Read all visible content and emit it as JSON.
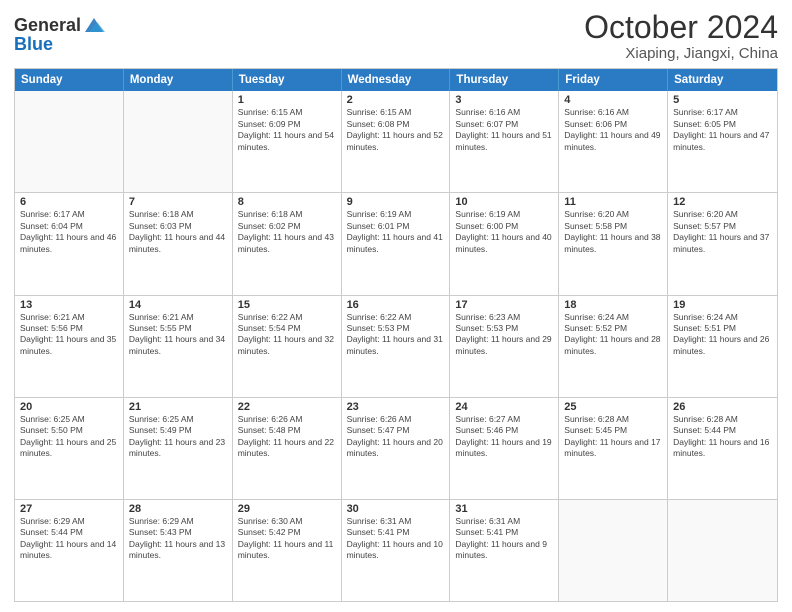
{
  "header": {
    "logo": {
      "general": "General",
      "blue": "Blue"
    },
    "title": "October 2024",
    "location": "Xiaping, Jiangxi, China"
  },
  "calendar": {
    "headers": [
      "Sunday",
      "Monday",
      "Tuesday",
      "Wednesday",
      "Thursday",
      "Friday",
      "Saturday"
    ],
    "weeks": [
      [
        {
          "day": "",
          "info": ""
        },
        {
          "day": "",
          "info": ""
        },
        {
          "day": "1",
          "info": "Sunrise: 6:15 AM\nSunset: 6:09 PM\nDaylight: 11 hours and 54 minutes."
        },
        {
          "day": "2",
          "info": "Sunrise: 6:15 AM\nSunset: 6:08 PM\nDaylight: 11 hours and 52 minutes."
        },
        {
          "day": "3",
          "info": "Sunrise: 6:16 AM\nSunset: 6:07 PM\nDaylight: 11 hours and 51 minutes."
        },
        {
          "day": "4",
          "info": "Sunrise: 6:16 AM\nSunset: 6:06 PM\nDaylight: 11 hours and 49 minutes."
        },
        {
          "day": "5",
          "info": "Sunrise: 6:17 AM\nSunset: 6:05 PM\nDaylight: 11 hours and 47 minutes."
        }
      ],
      [
        {
          "day": "6",
          "info": "Sunrise: 6:17 AM\nSunset: 6:04 PM\nDaylight: 11 hours and 46 minutes."
        },
        {
          "day": "7",
          "info": "Sunrise: 6:18 AM\nSunset: 6:03 PM\nDaylight: 11 hours and 44 minutes."
        },
        {
          "day": "8",
          "info": "Sunrise: 6:18 AM\nSunset: 6:02 PM\nDaylight: 11 hours and 43 minutes."
        },
        {
          "day": "9",
          "info": "Sunrise: 6:19 AM\nSunset: 6:01 PM\nDaylight: 11 hours and 41 minutes."
        },
        {
          "day": "10",
          "info": "Sunrise: 6:19 AM\nSunset: 6:00 PM\nDaylight: 11 hours and 40 minutes."
        },
        {
          "day": "11",
          "info": "Sunrise: 6:20 AM\nSunset: 5:58 PM\nDaylight: 11 hours and 38 minutes."
        },
        {
          "day": "12",
          "info": "Sunrise: 6:20 AM\nSunset: 5:57 PM\nDaylight: 11 hours and 37 minutes."
        }
      ],
      [
        {
          "day": "13",
          "info": "Sunrise: 6:21 AM\nSunset: 5:56 PM\nDaylight: 11 hours and 35 minutes."
        },
        {
          "day": "14",
          "info": "Sunrise: 6:21 AM\nSunset: 5:55 PM\nDaylight: 11 hours and 34 minutes."
        },
        {
          "day": "15",
          "info": "Sunrise: 6:22 AM\nSunset: 5:54 PM\nDaylight: 11 hours and 32 minutes."
        },
        {
          "day": "16",
          "info": "Sunrise: 6:22 AM\nSunset: 5:53 PM\nDaylight: 11 hours and 31 minutes."
        },
        {
          "day": "17",
          "info": "Sunrise: 6:23 AM\nSunset: 5:53 PM\nDaylight: 11 hours and 29 minutes."
        },
        {
          "day": "18",
          "info": "Sunrise: 6:24 AM\nSunset: 5:52 PM\nDaylight: 11 hours and 28 minutes."
        },
        {
          "day": "19",
          "info": "Sunrise: 6:24 AM\nSunset: 5:51 PM\nDaylight: 11 hours and 26 minutes."
        }
      ],
      [
        {
          "day": "20",
          "info": "Sunrise: 6:25 AM\nSunset: 5:50 PM\nDaylight: 11 hours and 25 minutes."
        },
        {
          "day": "21",
          "info": "Sunrise: 6:25 AM\nSunset: 5:49 PM\nDaylight: 11 hours and 23 minutes."
        },
        {
          "day": "22",
          "info": "Sunrise: 6:26 AM\nSunset: 5:48 PM\nDaylight: 11 hours and 22 minutes."
        },
        {
          "day": "23",
          "info": "Sunrise: 6:26 AM\nSunset: 5:47 PM\nDaylight: 11 hours and 20 minutes."
        },
        {
          "day": "24",
          "info": "Sunrise: 6:27 AM\nSunset: 5:46 PM\nDaylight: 11 hours and 19 minutes."
        },
        {
          "day": "25",
          "info": "Sunrise: 6:28 AM\nSunset: 5:45 PM\nDaylight: 11 hours and 17 minutes."
        },
        {
          "day": "26",
          "info": "Sunrise: 6:28 AM\nSunset: 5:44 PM\nDaylight: 11 hours and 16 minutes."
        }
      ],
      [
        {
          "day": "27",
          "info": "Sunrise: 6:29 AM\nSunset: 5:44 PM\nDaylight: 11 hours and 14 minutes."
        },
        {
          "day": "28",
          "info": "Sunrise: 6:29 AM\nSunset: 5:43 PM\nDaylight: 11 hours and 13 minutes."
        },
        {
          "day": "29",
          "info": "Sunrise: 6:30 AM\nSunset: 5:42 PM\nDaylight: 11 hours and 11 minutes."
        },
        {
          "day": "30",
          "info": "Sunrise: 6:31 AM\nSunset: 5:41 PM\nDaylight: 11 hours and 10 minutes."
        },
        {
          "day": "31",
          "info": "Sunrise: 6:31 AM\nSunset: 5:41 PM\nDaylight: 11 hours and 9 minutes."
        },
        {
          "day": "",
          "info": ""
        },
        {
          "day": "",
          "info": ""
        }
      ]
    ]
  }
}
